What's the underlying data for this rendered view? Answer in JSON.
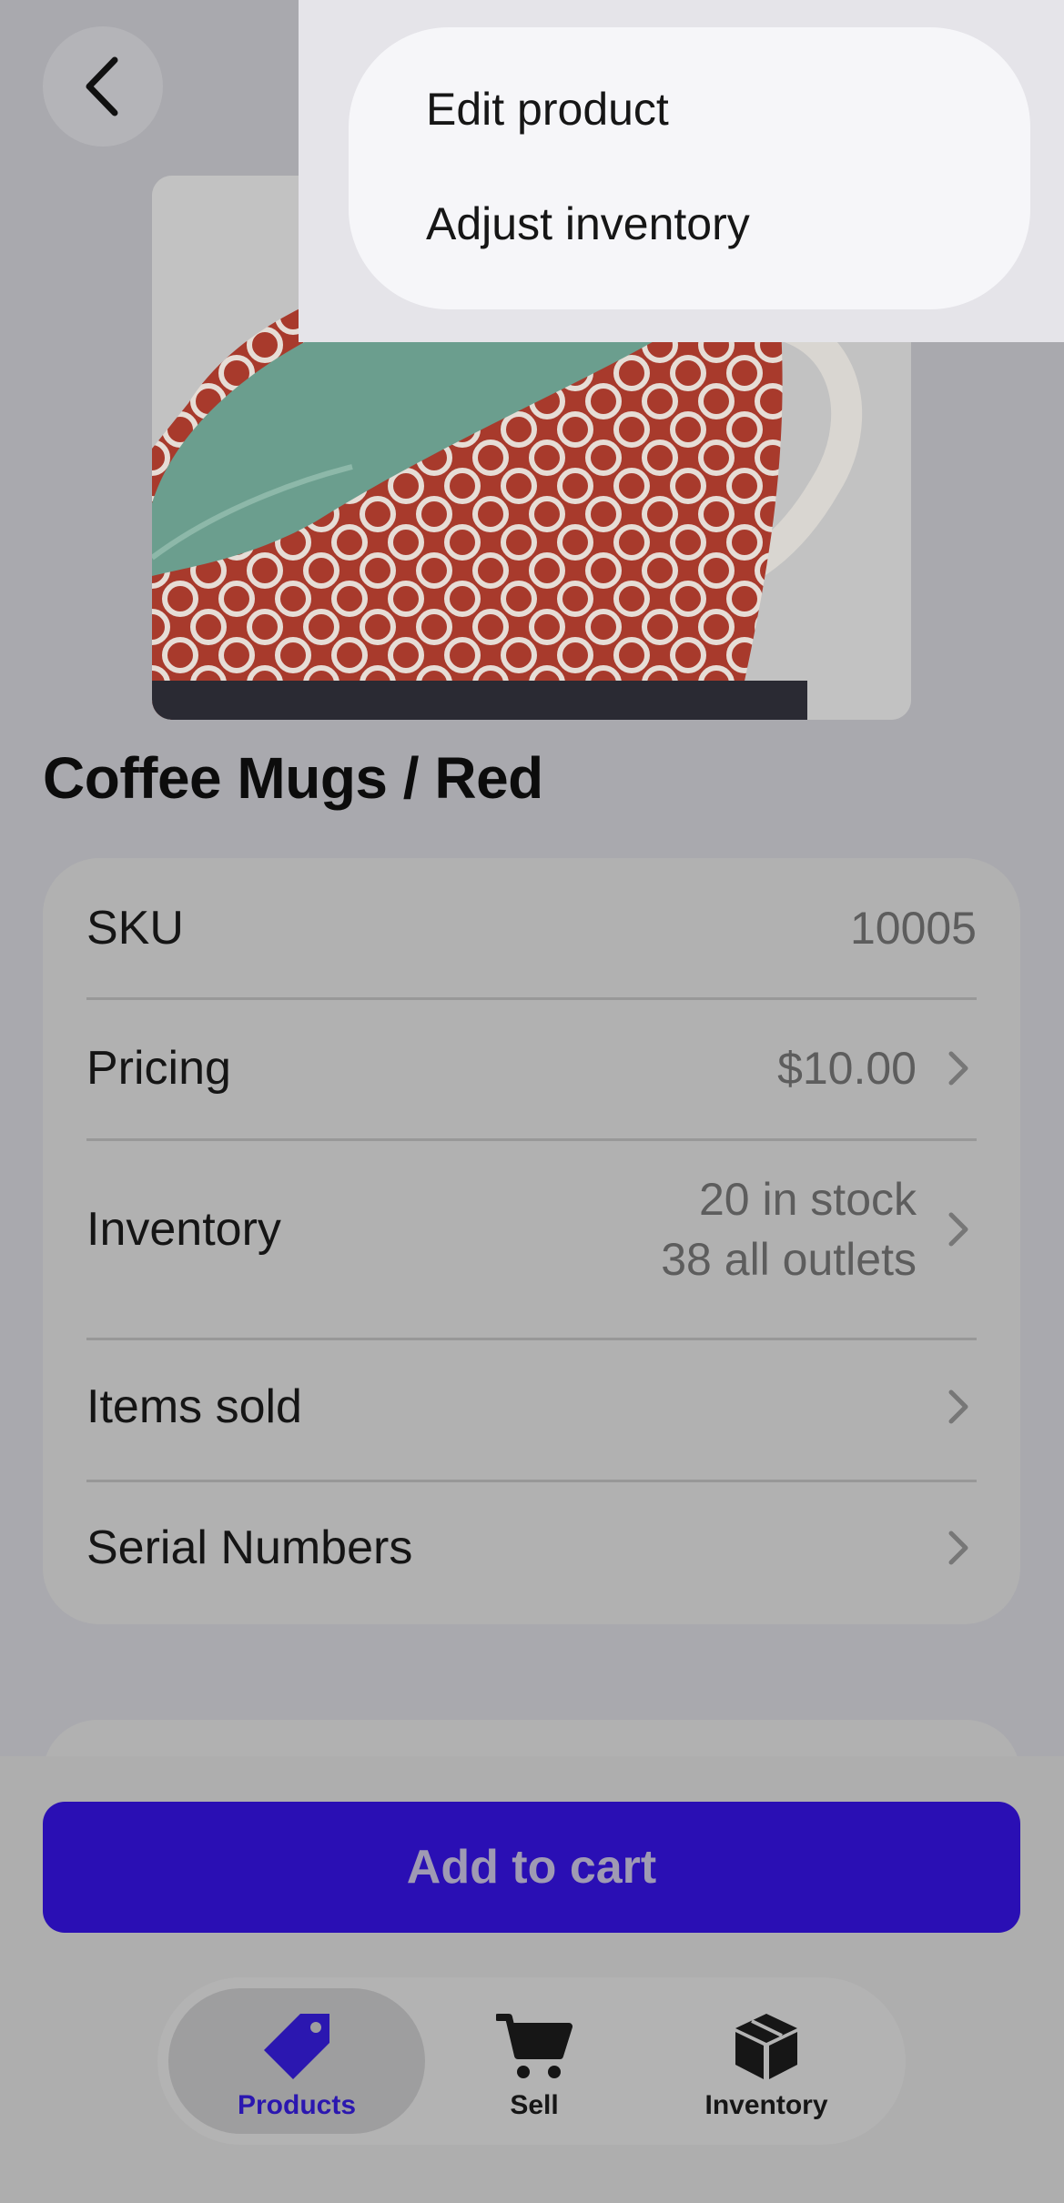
{
  "product": {
    "name": "Coffee Mugs / Red",
    "image_alt": "Red patterned coffee mug with teal interior"
  },
  "details": [
    {
      "label": "SKU",
      "value": "10005",
      "has_chevron": false
    },
    {
      "label": "Pricing",
      "value": "$10.00",
      "has_chevron": true
    },
    {
      "label": "Inventory",
      "value_line1": "20 in stock",
      "value_line2": "38 all outlets",
      "has_chevron": true
    },
    {
      "label": "Items sold",
      "value": "",
      "has_chevron": true
    },
    {
      "label": "Serial Numbers",
      "value": "",
      "has_chevron": true
    }
  ],
  "actions": {
    "add_to_cart": "Add to cart"
  },
  "menu": {
    "items": [
      "Edit product",
      "Adjust inventory"
    ]
  },
  "tabbar": {
    "tabs": [
      {
        "label": "Products",
        "icon": "tag-icon",
        "active": true
      },
      {
        "label": "Sell",
        "icon": "cart-icon",
        "active": false
      },
      {
        "label": "Inventory",
        "icon": "box-icon",
        "active": false
      }
    ]
  },
  "colors": {
    "accent": "#2a0fb4",
    "overlay": "#a9a9ae"
  }
}
